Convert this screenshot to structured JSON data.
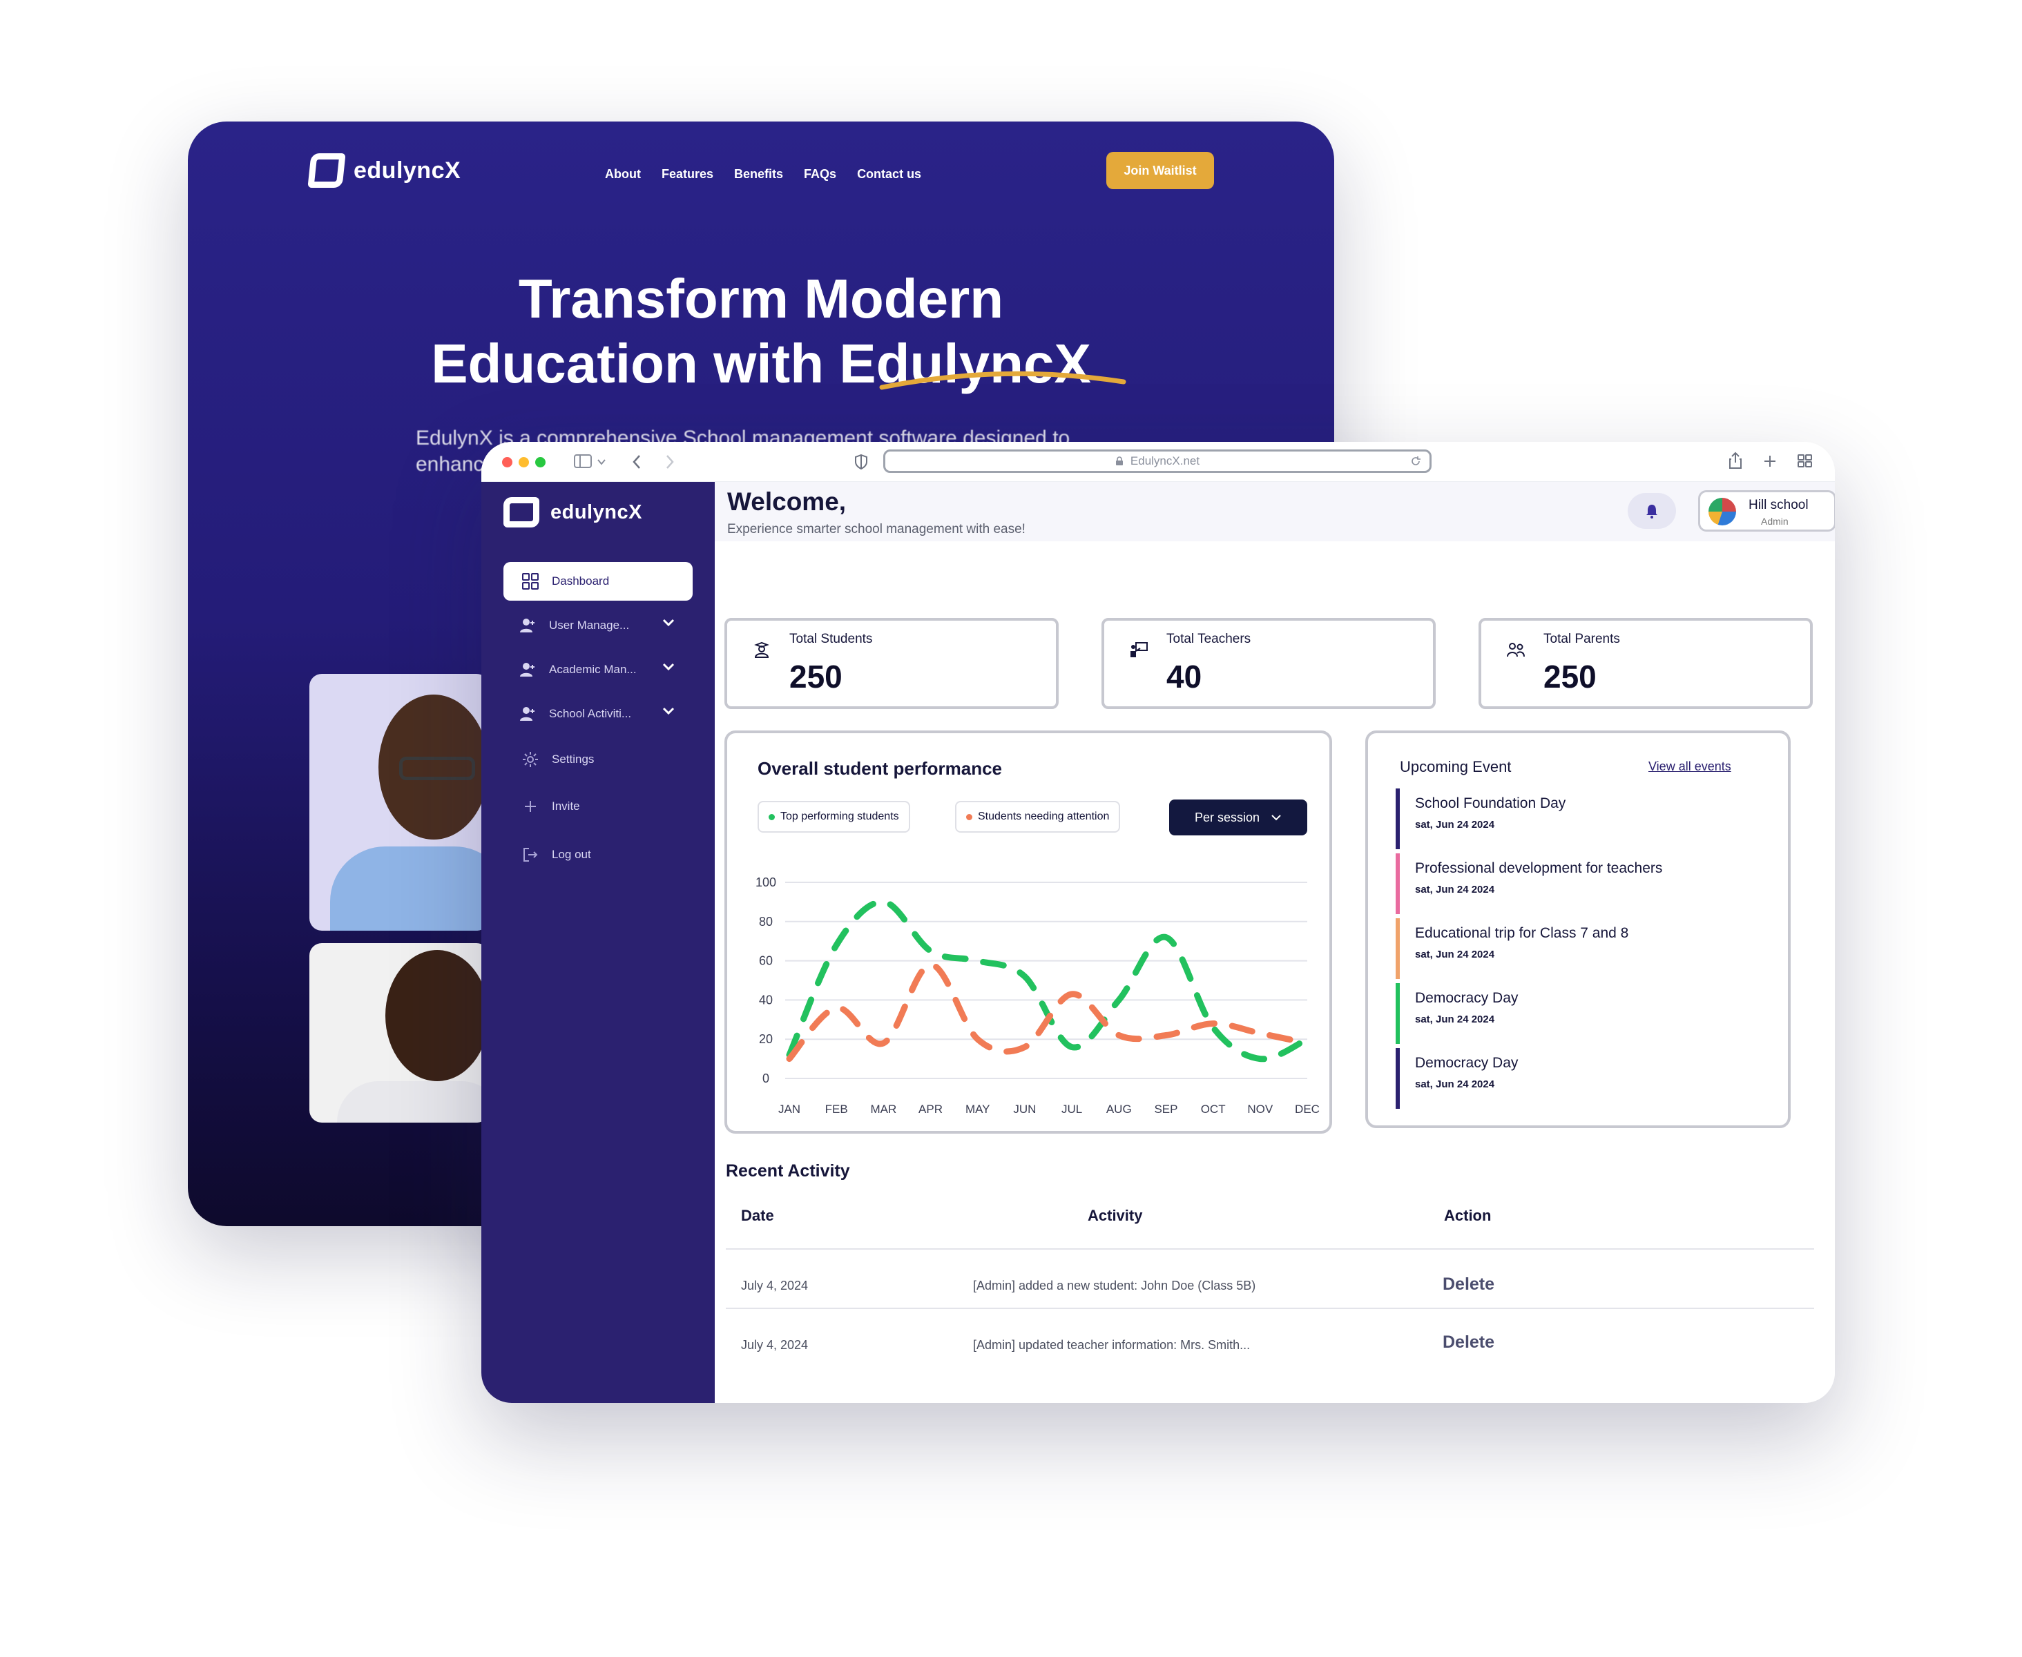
{
  "landing": {
    "brand": "edulyncX",
    "nav": [
      "About",
      "Features",
      "Benefits",
      "FAQs",
      "Contact us"
    ],
    "cta": "Join Waitlist",
    "hero_line1": "Transform Modern",
    "hero_line2": "Education with EdulyncX",
    "description": "EdulynX is a comprehensive School management software designed to enhance"
  },
  "browser": {
    "url": "EdulyncX.net"
  },
  "sidebar": {
    "brand": "edulyncX",
    "items": [
      {
        "label": "Dashboard",
        "icon": "grid-icon",
        "active": true
      },
      {
        "label": "User Manage...",
        "icon": "user-plus-icon",
        "expandable": true
      },
      {
        "label": "Academic Man...",
        "icon": "user-plus-icon",
        "expandable": true
      },
      {
        "label": "School Activiti...",
        "icon": "user-plus-icon",
        "expandable": true
      },
      {
        "label": "Settings",
        "icon": "gear-icon"
      },
      {
        "label": "Invite",
        "icon": "plus-icon"
      },
      {
        "label": "Log out",
        "icon": "logout-icon"
      }
    ]
  },
  "header": {
    "title": "Welcome,",
    "subtitle": "Experience smarter school management with ease!",
    "profile_name": "Hill school",
    "profile_role": "Admin"
  },
  "stats": [
    {
      "label": "Total Students",
      "value": "250",
      "icon": "student-icon"
    },
    {
      "label": "Total Teachers",
      "value": "40",
      "icon": "teacher-icon"
    },
    {
      "label": "Total Parents",
      "value": "250",
      "icon": "parents-icon"
    }
  ],
  "performance": {
    "title": "Overall student performance",
    "legend_top": "Top performing students",
    "legend_attention": "Students needing attention",
    "filter": "Per session"
  },
  "chart_data": {
    "type": "line",
    "categories": [
      "JAN",
      "FEB",
      "MAR",
      "APR",
      "MAY",
      "JUN",
      "JUL",
      "AUG",
      "SEP",
      "OCT",
      "NOV",
      "DEC"
    ],
    "ylim": [
      0,
      100
    ],
    "yticks": [
      0,
      20,
      40,
      60,
      80,
      100
    ],
    "series": [
      {
        "name": "Top performing students",
        "color": "#22c15e",
        "values": [
          12,
          68,
          90,
          65,
          60,
          52,
          16,
          40,
          72,
          26,
          10,
          20
        ]
      },
      {
        "name": "Students needing attention",
        "color": "#f17b55",
        "values": [
          10,
          36,
          18,
          58,
          20,
          16,
          43,
          22,
          22,
          28,
          23,
          18
        ]
      }
    ],
    "grid": true,
    "line_style": "dashed"
  },
  "events": {
    "title": "Upcoming Event",
    "view_all": "View all events",
    "items": [
      {
        "name": "School Foundation Day",
        "date": "sat, Jun 24 2024",
        "color": "#2b2170"
      },
      {
        "name": "Professional development for teachers",
        "date": "sat, Jun 24 2024",
        "color": "#e96b9f"
      },
      {
        "name": "Educational trip for Class 7 and 8",
        "date": "sat, Jun 24 2024",
        "color": "#f0a36b"
      },
      {
        "name": "Democracy Day",
        "date": "sat, Jun 24 2024",
        "color": "#22c15e"
      },
      {
        "name": "Democracy Day",
        "date": "sat, Jun 24 2024",
        "color": "#2b2170"
      }
    ]
  },
  "recent_activity": {
    "title": "Recent Activity",
    "columns": [
      "Date",
      "Activity",
      "Action"
    ],
    "rows": [
      {
        "date": "July 4, 2024",
        "activity": "[Admin] added a new student: John Doe (Class 5B)",
        "action": "Delete"
      },
      {
        "date": "July 4, 2024",
        "activity": "[Admin] updated teacher information: Mrs. Smith...",
        "action": "Delete"
      }
    ]
  }
}
